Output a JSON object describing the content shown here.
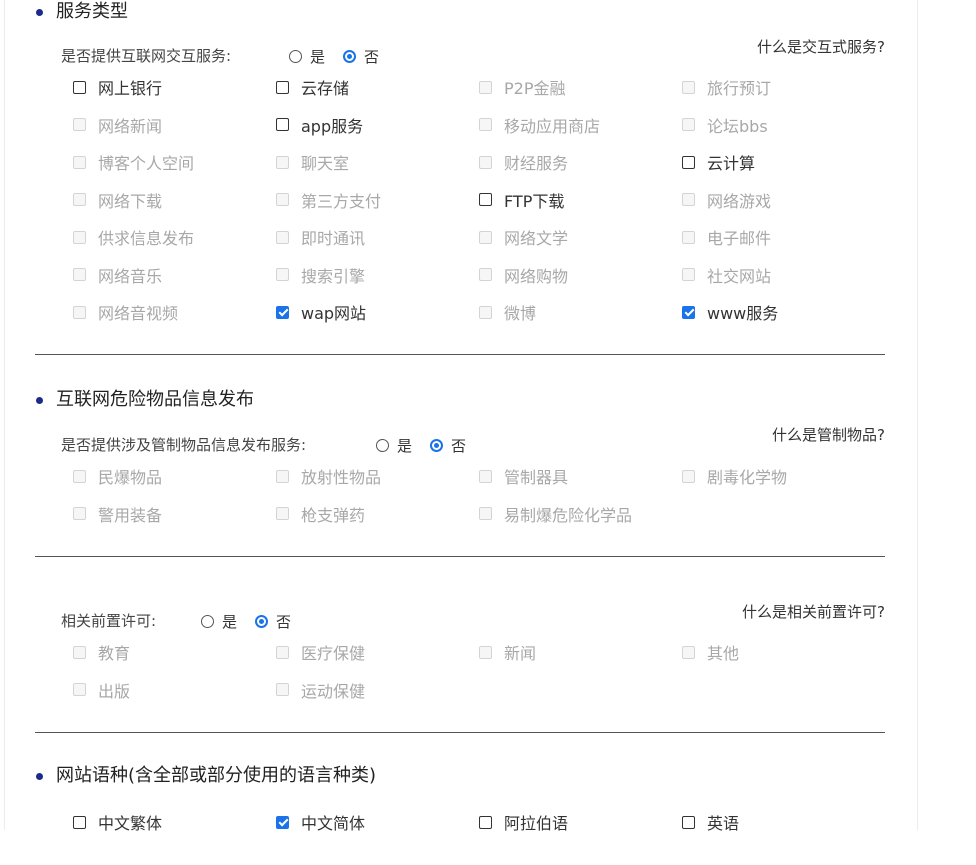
{
  "service_type": {
    "title": "服务类型",
    "question": "是否提供互联网交互服务:",
    "radio": {
      "yes": "是",
      "no": "否",
      "selected": "no"
    },
    "help": "什么是交互式服务?",
    "items": [
      {
        "label": "网上银行",
        "enabled": true,
        "checked": false
      },
      {
        "label": "云存储",
        "enabled": true,
        "checked": false
      },
      {
        "label": "P2P金融",
        "enabled": false,
        "checked": false
      },
      {
        "label": "旅行预订",
        "enabled": false,
        "checked": false
      },
      {
        "label": "网络新闻",
        "enabled": false,
        "checked": false
      },
      {
        "label": "app服务",
        "enabled": true,
        "checked": false
      },
      {
        "label": "移动应用商店",
        "enabled": false,
        "checked": false
      },
      {
        "label": "论坛bbs",
        "enabled": false,
        "checked": false
      },
      {
        "label": "博客个人空间",
        "enabled": false,
        "checked": false
      },
      {
        "label": "聊天室",
        "enabled": false,
        "checked": false
      },
      {
        "label": "财经服务",
        "enabled": false,
        "checked": false
      },
      {
        "label": "云计算",
        "enabled": true,
        "checked": false
      },
      {
        "label": "网络下载",
        "enabled": false,
        "checked": false
      },
      {
        "label": "第三方支付",
        "enabled": false,
        "checked": false
      },
      {
        "label": "FTP下载",
        "enabled": true,
        "checked": false
      },
      {
        "label": "网络游戏",
        "enabled": false,
        "checked": false
      },
      {
        "label": "供求信息发布",
        "enabled": false,
        "checked": false
      },
      {
        "label": "即时通讯",
        "enabled": false,
        "checked": false
      },
      {
        "label": "网络文学",
        "enabled": false,
        "checked": false
      },
      {
        "label": "电子邮件",
        "enabled": false,
        "checked": false
      },
      {
        "label": "网络音乐",
        "enabled": false,
        "checked": false
      },
      {
        "label": "搜索引擎",
        "enabled": false,
        "checked": false
      },
      {
        "label": "网络购物",
        "enabled": false,
        "checked": false
      },
      {
        "label": "社交网站",
        "enabled": false,
        "checked": false
      },
      {
        "label": "网络音视频",
        "enabled": false,
        "checked": false
      },
      {
        "label": "wap网站",
        "enabled": true,
        "checked": true
      },
      {
        "label": "微博",
        "enabled": false,
        "checked": false
      },
      {
        "label": "www服务",
        "enabled": true,
        "checked": true
      }
    ]
  },
  "dangerous_goods": {
    "title": "互联网危险物品信息发布",
    "question": "是否提供涉及管制物品信息发布服务:",
    "radio": {
      "yes": "是",
      "no": "否",
      "selected": "no"
    },
    "help": "什么是管制物品?",
    "items": [
      {
        "label": "民爆物品",
        "enabled": false,
        "checked": false
      },
      {
        "label": "放射性物品",
        "enabled": false,
        "checked": false
      },
      {
        "label": "管制器具",
        "enabled": false,
        "checked": false
      },
      {
        "label": "剧毒化学物",
        "enabled": false,
        "checked": false
      },
      {
        "label": "警用装备",
        "enabled": false,
        "checked": false
      },
      {
        "label": "枪支弹药",
        "enabled": false,
        "checked": false
      },
      {
        "label": "易制爆危险化学品",
        "enabled": false,
        "checked": false
      }
    ]
  },
  "pre_license": {
    "question": "相关前置许可:",
    "radio": {
      "yes": "是",
      "no": "否",
      "selected": "no"
    },
    "help": "什么是相关前置许可?",
    "items": [
      {
        "label": "教育",
        "enabled": false,
        "checked": false
      },
      {
        "label": "医疗保健",
        "enabled": false,
        "checked": false
      },
      {
        "label": "新闻",
        "enabled": false,
        "checked": false
      },
      {
        "label": "其他",
        "enabled": false,
        "checked": false
      },
      {
        "label": "出版",
        "enabled": false,
        "checked": false
      },
      {
        "label": "运动保健",
        "enabled": false,
        "checked": false
      }
    ]
  },
  "languages": {
    "title": "网站语种(含全部或部分使用的语言种类)",
    "items": [
      {
        "label": "中文繁体",
        "enabled": true,
        "checked": false
      },
      {
        "label": "中文简体",
        "enabled": true,
        "checked": true
      },
      {
        "label": "阿拉伯语",
        "enabled": true,
        "checked": false
      },
      {
        "label": "英语",
        "enabled": true,
        "checked": false
      }
    ]
  },
  "colors": {
    "accent": "#1a73e8",
    "bullet": "#1c2a8a",
    "disabled_text": "#a8a8a8"
  }
}
